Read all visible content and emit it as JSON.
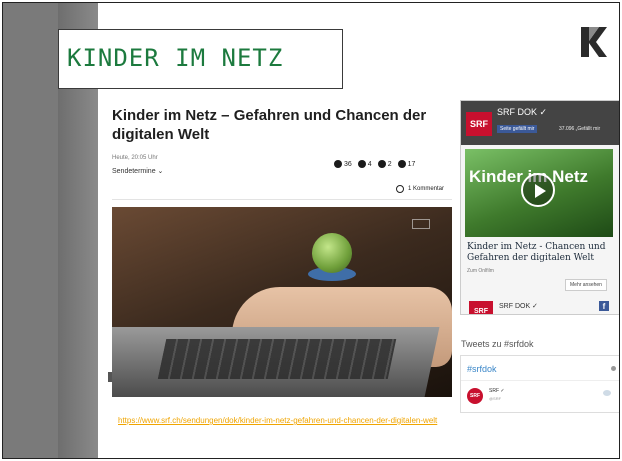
{
  "slide": {
    "title": "KINDER IM NETZ",
    "url": "https://www.srf.ch/sendungen/dok/kinder-im-netz-gefahren-und-chancen-der-digitalen-welt"
  },
  "article": {
    "title": "Kinder im Netz – Gefahren und Chancen der digitalen Welt",
    "date": "Heute, 20:05 Uhr",
    "sendetermine": "Sendetermine ⌄",
    "shares": [
      "36",
      "4",
      "2",
      "17"
    ],
    "comments": "1 Kommentar"
  },
  "facebook": {
    "badge": "SRF",
    "page_name": "SRF DOK ✓",
    "like_button": "Seite gefällt mir",
    "likes": "37.096 „Gefällt mir",
    "thumb_text": "Kinder im Netz",
    "post_title": "Kinder im Netz - Chancen und Gefahren der digitalen Welt",
    "post_sub": "Zum Onlfilm",
    "more_button": "Mehr ansehen",
    "footer_badge": "SRF",
    "footer_name": "SRF DOK ✓",
    "footer_icon": "f"
  },
  "tweets": {
    "heading": "Tweets zu #srfdok",
    "hashtag": "#srfdok",
    "avatar": "SRF",
    "user": "SRF ✓",
    "handle": "@SRF"
  },
  "colors": {
    "title_green": "#1c7a3e",
    "url_orange": "#f0a500",
    "srf_red": "#c8102e",
    "facebook_blue": "#3b5998"
  }
}
